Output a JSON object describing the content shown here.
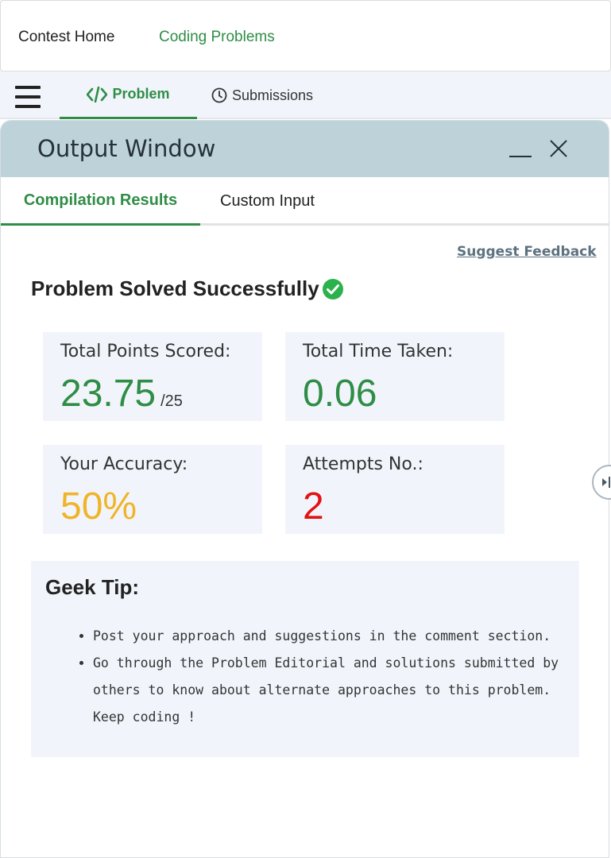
{
  "top_nav": {
    "contest_home": "Contest Home",
    "coding_problems": "Coding Problems"
  },
  "tabs": {
    "problem": "Problem",
    "submissions": "Submissions"
  },
  "output_window": {
    "title": "Output Window",
    "tabs": {
      "compilation": "Compilation Results",
      "custom_input": "Custom Input"
    },
    "suggest_feedback": "Suggest Feedback",
    "status": "Problem Solved Successfully",
    "stats": {
      "points_label": "Total Points Scored:",
      "points_value": "23.75",
      "points_max": "/25",
      "time_label": "Total Time Taken:",
      "time_value": "0.06",
      "accuracy_label": "Your Accuracy:",
      "accuracy_value": "50%",
      "attempts_label": "Attempts No.:",
      "attempts_value": "2"
    },
    "tip": {
      "title": "Geek Tip:",
      "items": [
        "Post your approach and suggestions in the comment section.",
        "Go through the Problem Editorial and solutions submitted by others to know about alternate approaches to this problem. Keep coding !"
      ]
    }
  },
  "colors": {
    "accent_green": "#2f8d46",
    "header_bg": "#bdd3d9",
    "card_bg": "#f1f5fb",
    "accuracy": "#f0b429",
    "attempts": "#e31212",
    "success_check": "#2bb24c"
  },
  "icons": [
    "menu-icon",
    "code-icon",
    "clock-icon",
    "minimize-icon",
    "close-icon",
    "check-circle-icon",
    "collapse-handle-icon"
  ]
}
